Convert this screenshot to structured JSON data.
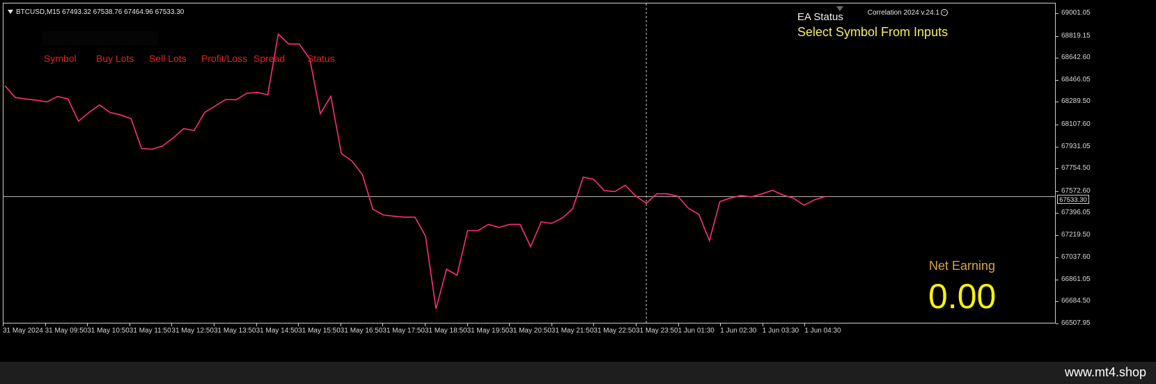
{
  "header": {
    "symbol": "BTCUSD,M15",
    "ohlc": "67493.32 67538.76 67464.96 67533.30",
    "ea_name": "Correlation 2024 v.24.1",
    "ea_icon": "smiley-icon"
  },
  "ea_status": {
    "title": "EA Status",
    "message": "Select Symbol From Inputs"
  },
  "table": {
    "headers": [
      "Symbol",
      "Buy Lots",
      "Sell Lots",
      "Profit/Loss",
      "Spread",
      "Status"
    ]
  },
  "net_earning": {
    "label": "Net Earning",
    "value": "0.00"
  },
  "current_price": "67533.30",
  "price_axis": [
    "69001.05",
    "68819.15",
    "68642.60",
    "68466.05",
    "68289.50",
    "68107.60",
    "67931.05",
    "67754.50",
    "67572.60",
    "67396.05",
    "67219.50",
    "67037.60",
    "66861.05",
    "66684.50",
    "66507.95"
  ],
  "time_axis": [
    "31 May 2024",
    "31 May 09:50",
    "31 May 10:50",
    "31 May 11:50",
    "31 May 12:50",
    "31 May 13:50",
    "31 May 14:50",
    "31 May 15:50",
    "31 May 16:50",
    "31 May 17:50",
    "31 May 18:50",
    "31 May 19:50",
    "31 May 20:50",
    "31 May 21:50",
    "31 May 22:50",
    "31 May 23:50",
    "1 Jun 01:30",
    "1 Jun 02:30",
    "1 Jun 03:30",
    "1 Jun 04:30"
  ],
  "chart_data": {
    "type": "line",
    "ylim": [
      66507.95,
      69086.0
    ],
    "series": [
      {
        "color": "#ff2e7e",
        "values": [
          68425,
          68330,
          68318,
          68308,
          68295,
          68338,
          68320,
          68140,
          68210,
          68270,
          68210,
          68190,
          68160,
          67920,
          67914,
          67940,
          68005,
          68080,
          68065,
          68210,
          68262,
          68314,
          68312,
          68364,
          68372,
          68352,
          68840,
          68760,
          68760,
          68640,
          68200,
          68340,
          67880,
          67820,
          67710,
          67432,
          67386,
          67376,
          67368,
          67368,
          67216,
          66632,
          66950,
          66902,
          67260,
          67260,
          67310,
          67286,
          67310,
          67310,
          67130,
          67330,
          67318,
          67360,
          67436,
          67690,
          67672,
          67582,
          67574,
          67624,
          67538,
          67480,
          67556,
          67556,
          67536,
          67440,
          67390,
          67180,
          67494,
          67522,
          67542,
          67532,
          67556,
          67584,
          67546,
          67520,
          67464,
          67508,
          67533
        ]
      }
    ],
    "crosshair_index": 61
  },
  "footer": {
    "text": "www.mt4.shop"
  }
}
